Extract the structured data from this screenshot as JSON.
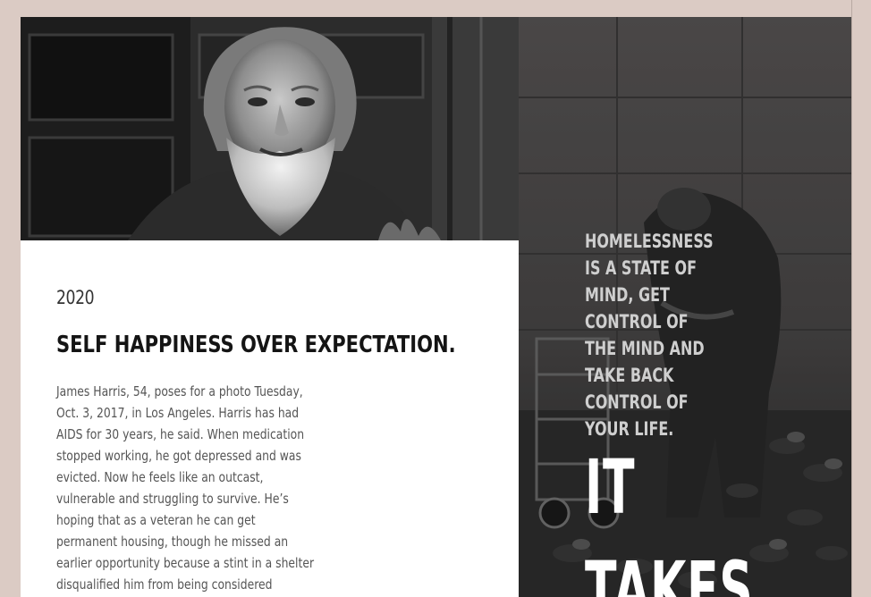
{
  "article": {
    "year": "2020",
    "headline": "SELF HAPPINESS OVER EXPECTATION.",
    "caption": "James Harris, 54, poses for a photo Tuesday, Oct. 3, 2017, in Los Angeles. Harris has had AIDS for 30 years, he said. When medication stopped working, he got depressed and was evicted. Now he feels like an outcast, vulnerable and struggling to survive. He’s hoping that as a veteran he can get permanent housing, though he missed an earlier opportunity because a stint in a shelter disqualified him from being considered chronically homeless. (AP Photo/Jae C. Hong)."
  },
  "side_panel": {
    "quote": "HOMELESSNESS IS A STATE OF MIND, GET CONTROL OF THE MIND AND TAKE BACK CONTROL OF YOUR LIFE.",
    "big_word_1": "IT",
    "big_word_2": "TAKES"
  },
  "colors": {
    "page_background": "#dbcbc4",
    "card_background": "#ffffff",
    "headline": "#141414",
    "caption": "#555555",
    "quote": "#cfcfcf",
    "big_word": "#ffffff"
  },
  "images": {
    "top_photo": "bearded-man-portrait-photo",
    "side_photo": "man-with-pigeons-photo"
  }
}
